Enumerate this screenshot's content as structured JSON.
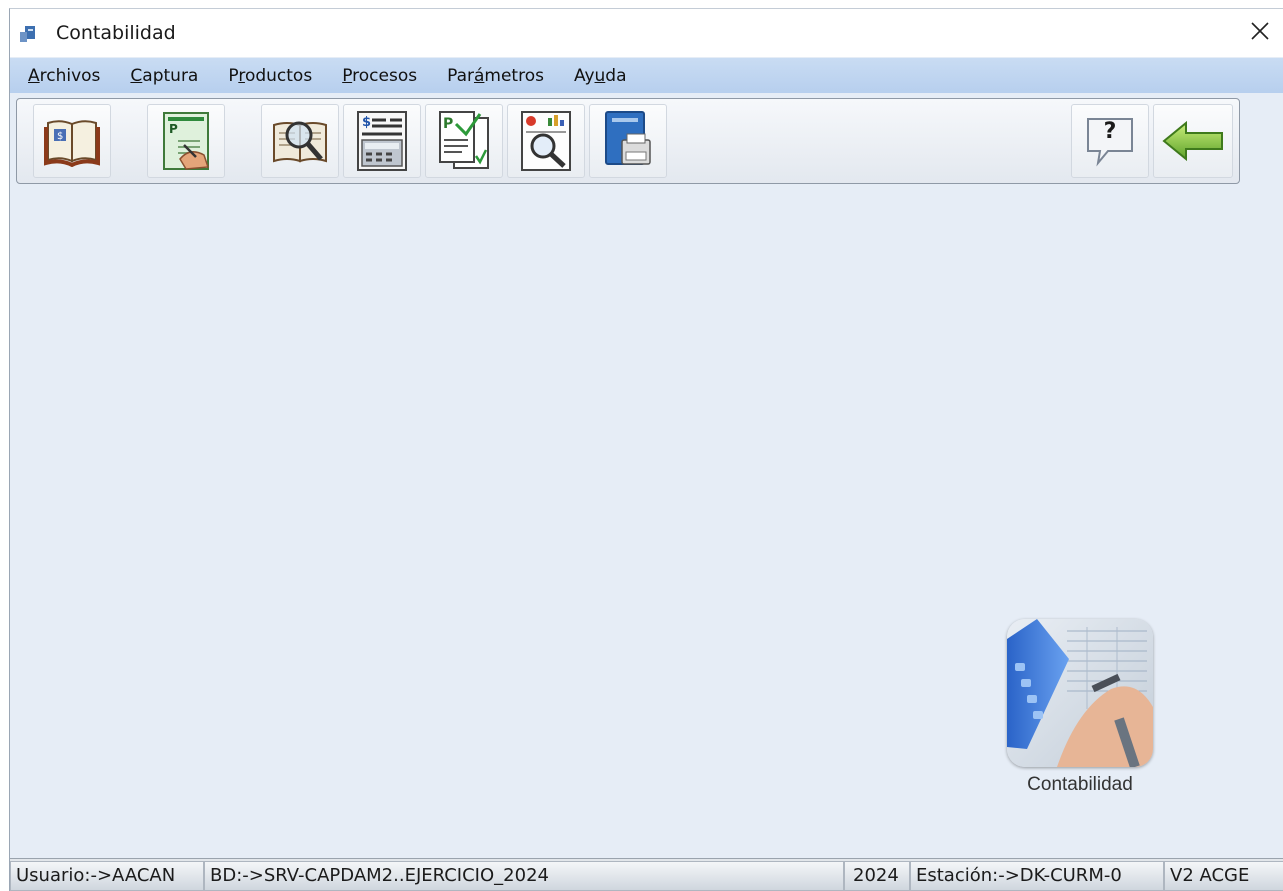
{
  "window": {
    "title": "Contabilidad",
    "close_symbol": "✕"
  },
  "menu": [
    {
      "pre": "",
      "acc": "A",
      "post": "rchivos"
    },
    {
      "pre": "",
      "acc": "C",
      "post": "aptura"
    },
    {
      "pre": "P",
      "acc": "r",
      "post": "oductos"
    },
    {
      "pre": "",
      "acc": "P",
      "post": "rocesos"
    },
    {
      "pre": "Par",
      "acc": "á",
      "post": "metros"
    },
    {
      "pre": "Ay",
      "acc": "u",
      "post": "da"
    }
  ],
  "toolbar": {
    "icons": [
      "ledger-book-icon",
      "capture-form-icon",
      "search-book-icon",
      "calculator-report-icon",
      "verify-documents-icon",
      "report-search-icon",
      "print-book-icon",
      "help-icon",
      "back-arrow-icon"
    ],
    "help_label": "?"
  },
  "desktop_icon": {
    "label": "Contabilidad"
  },
  "status": {
    "usuario": "Usuario:->AACAN",
    "bd": "BD:->SRV-CAPDAM2..EJERCICIO_2024",
    "year": "2024",
    "estacion": "Estación:->DK-CURM-0",
    "version": "V2 ACGE"
  },
  "colors": {
    "menubar": "#b7cfee",
    "client_bg": "#e6edf6",
    "accent_green": "#7bc043"
  }
}
